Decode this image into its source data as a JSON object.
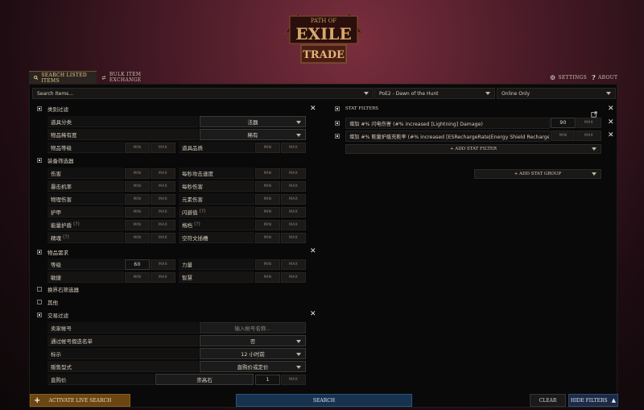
{
  "logo": {
    "line1": "PATH OF",
    "line2": "EXILE",
    "line3": "TRADE"
  },
  "tabs": [
    {
      "label": "Search Listed Items",
      "icon": "search-icon"
    },
    {
      "label": "Bulk Item Exchange",
      "icon": "exchange-icon"
    }
  ],
  "top_right": {
    "settings": "Settings",
    "about": "About"
  },
  "search": {
    "placeholder": "Search Items...",
    "league": "PoE2 - Dawn of the Hunt",
    "status": "Online Only"
  },
  "type_filters": {
    "title": "类别过滤",
    "category_label": "道具分类",
    "category_value": "法器",
    "rarity_label": "物品稀有度",
    "rarity_value": "稀有",
    "ilvl_label": "物品等级",
    "quality_label": "道具品质"
  },
  "equipment_filters": {
    "title": "装备筛选器",
    "rows": [
      [
        "伤害",
        "每秒攻击速度"
      ],
      [
        "暴击机率",
        "每秒伤害"
      ],
      [
        "物理伤害",
        "元素伤害"
      ],
      [
        "护甲",
        "闪避值"
      ],
      [
        "能量护盾",
        "格档"
      ],
      [
        "精魂",
        "空符文插槽"
      ]
    ],
    "hint": "(?)"
  },
  "requirements": {
    "title": "物品需求",
    "level": "等级",
    "level_min": "60",
    "str": "力量",
    "dex": "敏捷",
    "int": "智慧"
  },
  "misc": {
    "map_filters": "换界石筛选器",
    "other": "其他"
  },
  "trade_filters": {
    "title": "交易过滤",
    "seller_label": "卖家帐号",
    "seller_placeholder": "输入帐号名称...",
    "collapse_label": "通过帐号摺迭名单",
    "collapse_value": "否",
    "listed_label": "标示",
    "listed_value": "12 小时前",
    "sale_label": "贩售型式",
    "sale_value": "直购价或定价",
    "price_label": "直购价",
    "price_currency": "崇高石",
    "price_min": "1"
  },
  "stat_filters": {
    "title": "Stat Filters",
    "rows": [
      {
        "text": "增加 #% 闪电伤害 (#% increased [Lightning] Damage)",
        "min": "90",
        "max": "MAX"
      },
      {
        "text": "增加 #% 能量护盾充能率 (#% increased [ESRechargeRate|Energy Shield Recharge Rate])",
        "min": "MIN",
        "max": "MAX"
      }
    ],
    "add_stat": "+ Add Stat Filter",
    "add_group": "+ Add Stat Group"
  },
  "minmax": {
    "min": "MIN",
    "max": "MAX"
  },
  "footer": {
    "live": "Activate Live Search",
    "search": "Search",
    "clear": "Clear",
    "hide": "Hide Filters"
  },
  "colors": {
    "accent": "#e7c98a",
    "live_bg": "#6b4512",
    "search_bg": "#17324f",
    "hide_bg": "#1d2a44"
  }
}
